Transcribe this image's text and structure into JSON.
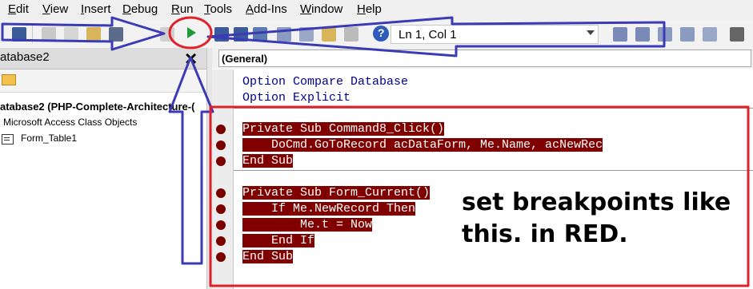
{
  "menu": {
    "items": [
      {
        "u": "E",
        "rest": "dit"
      },
      {
        "u": "V",
        "rest": "iew"
      },
      {
        "u": "I",
        "rest": "nsert"
      },
      {
        "u": "D",
        "rest": "ebug"
      },
      {
        "u": "R",
        "rest": "un"
      },
      {
        "u": "T",
        "rest": "ools"
      },
      {
        "u": "A",
        "rest": "dd-Ins"
      },
      {
        "u": "W",
        "rest": "indow"
      },
      {
        "u": "H",
        "rest": "elp"
      }
    ]
  },
  "toolbar": {
    "position_text": "Ln 1, Col 1",
    "run_icon": "play-icon",
    "help_icon": "help-icon"
  },
  "project": {
    "title": "atabase2",
    "root": "atabase2 (PHP-Complete-Architecture-(",
    "folder": "Microsoft Access Class Objects",
    "form": "Form_Table1"
  },
  "code": {
    "object_box": "(General)",
    "header_lines": [
      {
        "kw": "Option Compare Database"
      },
      {
        "kw": "Option Explicit"
      }
    ],
    "proc1": [
      "Private Sub Command8_Click()",
      "    DoCmd.GoToRecord acDataForm, Me.Name, acNewRec",
      "End Sub"
    ],
    "proc2": [
      "Private Sub Form_Current()",
      "    If Me.NewRecord Then",
      "        Me.t = Now",
      "    End If",
      "End Sub"
    ]
  },
  "annotation": {
    "line1": "set breakpoints like",
    "line2": "this.  in RED.",
    "colors": {
      "red": "#e0202a",
      "blue": "#3b3bb5",
      "breakpoint": "#7a0000"
    }
  }
}
